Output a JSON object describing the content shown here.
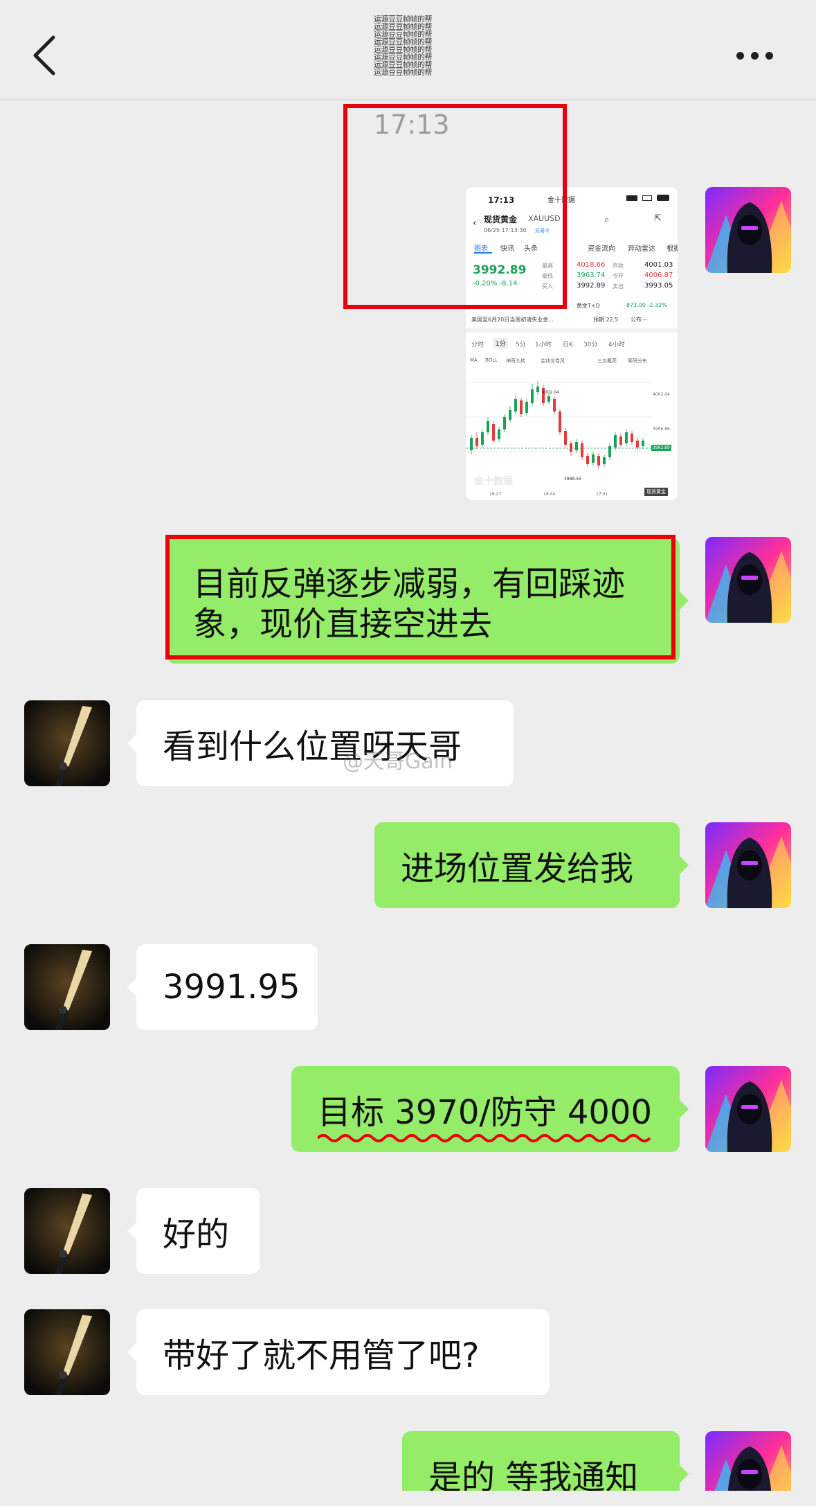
{
  "header": {
    "back_icon": "chevron-left-icon",
    "more_icon": "more-dots-icon",
    "title_scramble": "运源豆豆帧帧的帮\n运源豆豆帧帧的帮\n运源豆豆帧帧的帮\n运源豆豆帧帧的帮\n运源豆豆帧帧的帮\n运源豆豆帧帧的帮\n运源豆豆帧帧的帮\n运源豆豆帧帧的帮"
  },
  "chat": {
    "timestamp": "17:13",
    "screenshot": {
      "status_time": "17:13",
      "app_tag": "金十数据",
      "title": "现货黄金",
      "symbol": "XAUUSD",
      "datetime": "06/25 17:13:30",
      "status": "交易中",
      "tabs": [
        "图表",
        "快讯",
        "头条",
        "资金流向",
        "异动雷达",
        "根据"
      ],
      "price": "3992.89",
      "change": "-0.20%  -8.14",
      "high_label": "最高",
      "high": "4018.66",
      "low_label": "最低",
      "low": "3963.74",
      "buy_label": "买入",
      "buy": "3992.89",
      "prev_label": "昨收",
      "prev": "4001.03",
      "open_label": "今开",
      "open": "4006.87",
      "sell_label": "卖出",
      "sell": "3993.05",
      "td_label": "黄金T+D",
      "td_value": "873.00  -2.32%",
      "news": "美国至6月20日当周初请失业金...",
      "news_expect": "预期 22.5",
      "news_pub": "公布 --",
      "periods": [
        "分时",
        "1分",
        "5分",
        "1小时",
        "日K",
        "30分",
        "4小时"
      ],
      "indicators": [
        "MA",
        "BOLL",
        "神奇九转",
        "金钱龙卷风",
        "三叉戴高",
        "筹码分布"
      ],
      "y_labels": [
        "4002.04",
        "3996.86",
        "3992.89"
      ],
      "low_mark": "3988.56",
      "peak_mark": "4002.04",
      "x_labels": [
        "16:27",
        "16:44",
        "17:01"
      ],
      "watermark": "金十数据",
      "corner_tag": "现货黄金"
    },
    "messages": [
      {
        "text_line1": "目前反弹逐步减弱，有回踩迹",
        "text_line2": "象，现价直接空进去"
      },
      {
        "text": "看到什么位置呀天哥"
      },
      {
        "text": "进场位置发给我"
      },
      {
        "text": "3991.95"
      },
      {
        "text": "目标 3970/防守 4000"
      },
      {
        "text": "好的"
      },
      {
        "text": "带好了就不用管了吧?"
      },
      {
        "text": "是的 等我通知"
      }
    ],
    "watermark": "@天哥Gain"
  },
  "colors": {
    "bubble_green": "#95ec69",
    "bubble_white": "#ffffff",
    "background": "#ededed",
    "highlight_red": "#e8000d"
  }
}
